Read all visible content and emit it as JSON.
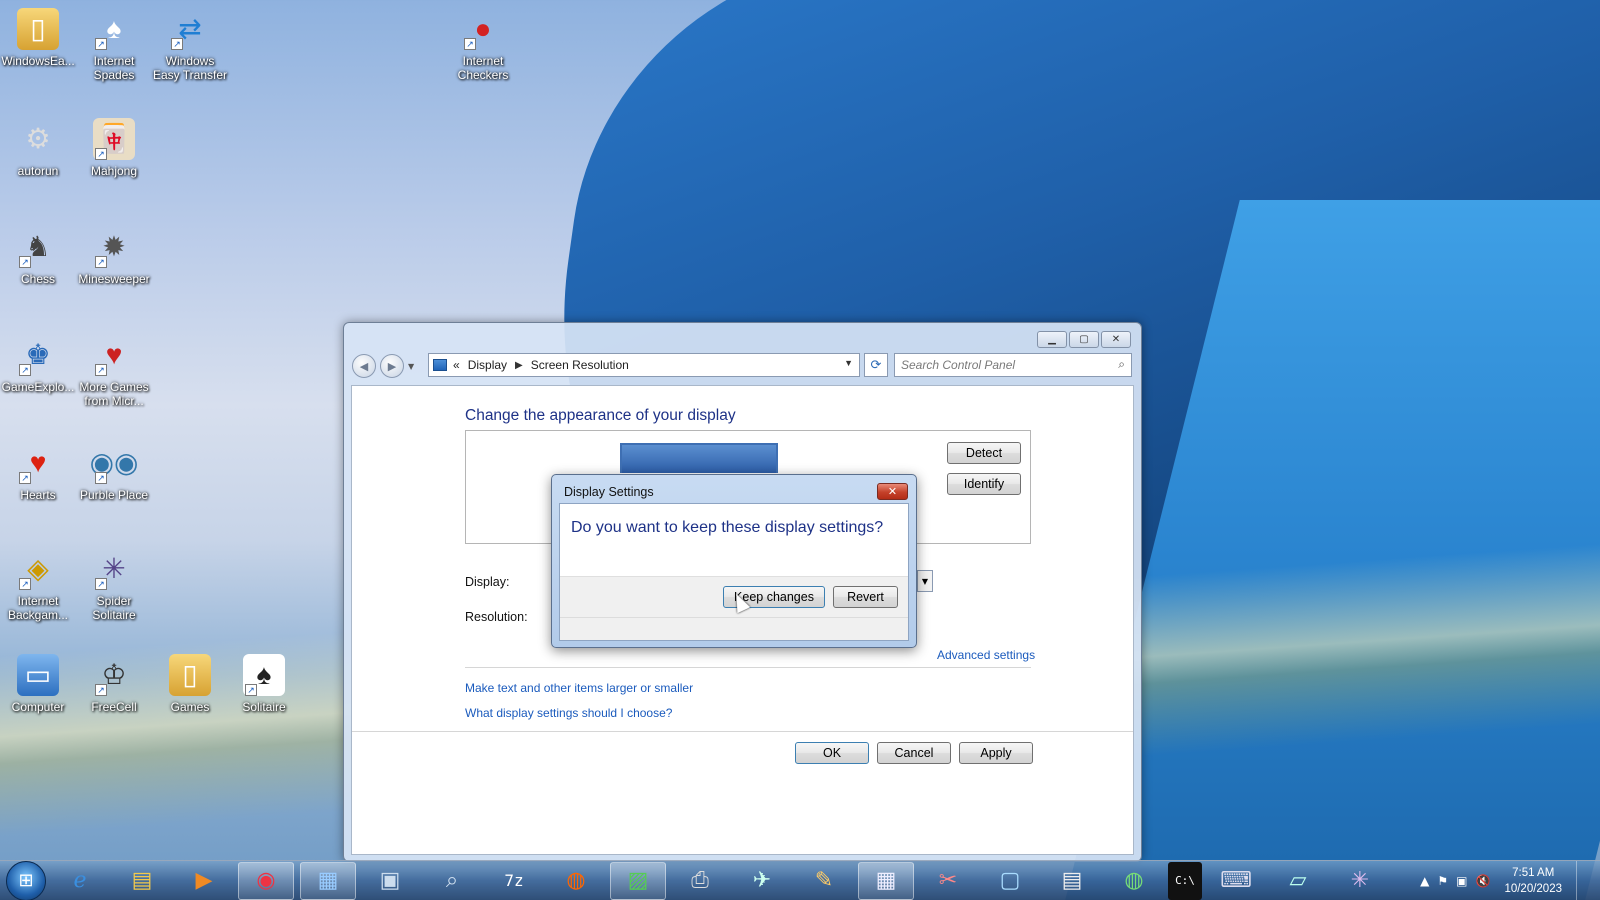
{
  "desktop": {
    "icons": [
      {
        "label": "WindowsEa...",
        "icon": "folder-icon"
      },
      {
        "label": "Internet Spades",
        "icon": "spades-icon"
      },
      {
        "label": "Windows Easy Transfer",
        "icon": "easy-transfer-icon"
      },
      {
        "label": "Internet Checkers",
        "icon": "checkers-icon"
      },
      {
        "label": "autorun",
        "icon": "autorun-icon"
      },
      {
        "label": "Mahjong",
        "icon": "mahjong-icon"
      },
      {
        "label": "Chess",
        "icon": "chess-icon"
      },
      {
        "label": "Minesweeper",
        "icon": "minesweeper-icon"
      },
      {
        "label": "GameExplo...",
        "icon": "game-explorer-icon"
      },
      {
        "label": "More Games from Micr...",
        "icon": "more-games-icon"
      },
      {
        "label": "Hearts",
        "icon": "hearts-icon"
      },
      {
        "label": "Purble Place",
        "icon": "purble-place-icon"
      },
      {
        "label": "Internet Backgam...",
        "icon": "backgammon-icon"
      },
      {
        "label": "Spider Solitaire",
        "icon": "spider-solitaire-icon"
      },
      {
        "label": "Computer",
        "icon": "computer-icon"
      },
      {
        "label": "FreeCell",
        "icon": "freecell-icon"
      },
      {
        "label": "Games",
        "icon": "games-folder-icon"
      },
      {
        "label": "Solitaire",
        "icon": "solitaire-icon"
      }
    ]
  },
  "window": {
    "breadcrumb": {
      "root_marker": "«",
      "item1": "Display",
      "item2": "Screen Resolution"
    },
    "search_placeholder": "Search Control Panel",
    "page_title": "Change the appearance of your display",
    "detect_label": "Detect",
    "identify_label": "Identify",
    "display_label": "Display:",
    "resolution_label": "Resolution:",
    "advanced_link": "Advanced settings",
    "link_text_size": "Make text and other items larger or smaller",
    "link_choose": "What display settings should I choose?",
    "ok_label": "OK",
    "cancel_label": "Cancel",
    "apply_label": "Apply"
  },
  "dialog": {
    "title": "Display Settings",
    "question": "Do you want to keep these display settings?",
    "keep_label": "Keep changes",
    "revert_label": "Revert"
  },
  "taskbar": {
    "items": [
      "ie-icon",
      "explorer-icon",
      "media-player-icon",
      "chrome-icon",
      "control-panel-icon",
      "network-icon",
      "magnifier-icon",
      "7zip-icon",
      "firefox-icon",
      "chart-app-icon",
      "printer-icon",
      "airplane-icon",
      "paint-icon",
      "calculator-icon",
      "snipping-tool-icon",
      "remote-desktop-icon",
      "notepad-icon",
      "globe-icon",
      "cmd-icon",
      "keyboard-icon",
      "sticky-notes-icon",
      "spider-icon"
    ],
    "time": "7:51 AM",
    "date": "10/20/2023"
  },
  "colors": {
    "link": "#1b5bbd",
    "heading": "#1e3287",
    "close_red": "#c4412a"
  }
}
